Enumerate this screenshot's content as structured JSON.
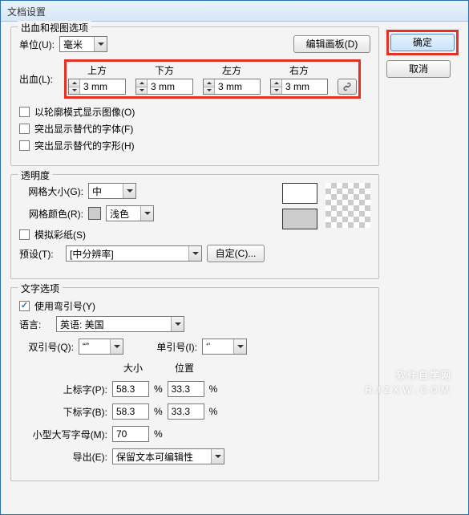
{
  "window": {
    "title": "文档设置"
  },
  "buttons": {
    "ok": "确定",
    "cancel": "取消",
    "edit_artboards": "编辑画板(D)"
  },
  "bleed_section": {
    "legend": "出血和视图选项",
    "units_label": "单位(U):",
    "units_value": "毫米",
    "bleed_label": "出血(L):",
    "headers": {
      "top": "上方",
      "bottom": "下方",
      "left": "左方",
      "right": "右方"
    },
    "values": {
      "top": "3 mm",
      "bottom": "3 mm",
      "left": "3 mm",
      "right": "3 mm"
    },
    "checks": {
      "outline": "以轮廓模式显示图像(O)",
      "sub_fonts": "突出显示替代的字体(F)",
      "sub_glyphs": "突出显示替代的字形(H)"
    }
  },
  "transparency": {
    "legend": "透明度",
    "grid_size_label": "网格大小(G):",
    "grid_size_value": "中",
    "grid_color_label": "网格颜色(R):",
    "grid_color_value": "浅色",
    "grid_color_swatch": "#cccccc",
    "simulate_label": "模拟彩纸(S)",
    "preset_label": "预设(T):",
    "preset_value": "[中分辨率]",
    "custom_btn": "自定(C)...",
    "swatch_white": "#ffffff",
    "swatch_grey": "#cccccc"
  },
  "type": {
    "legend": "文字选项",
    "curly_quotes": "使用弯引号(Y)",
    "curly_checked": true,
    "language_label": "语言:",
    "language_value": "英语: 美国",
    "dquote_label": "双引号(Q):",
    "dquote_value": "“”",
    "squote_label": "单引号(I):",
    "squote_value": "‘’",
    "size_header": "大小",
    "pos_header": "位置",
    "superscript_label": "上标字(P):",
    "subscript_label": "下标字(B):",
    "smallcaps_label": "小型大写字母(M):",
    "export_label": "导出(E):",
    "export_value": "保留文本可编辑性",
    "percent": "%",
    "vals": {
      "sup_size": "58.3",
      "sup_pos": "33.3",
      "sub_size": "58.3",
      "sub_pos": "33.3",
      "sc_size": "70"
    }
  },
  "watermark": {
    "main": "软件自学网",
    "sub": "RJZXW.COM"
  }
}
